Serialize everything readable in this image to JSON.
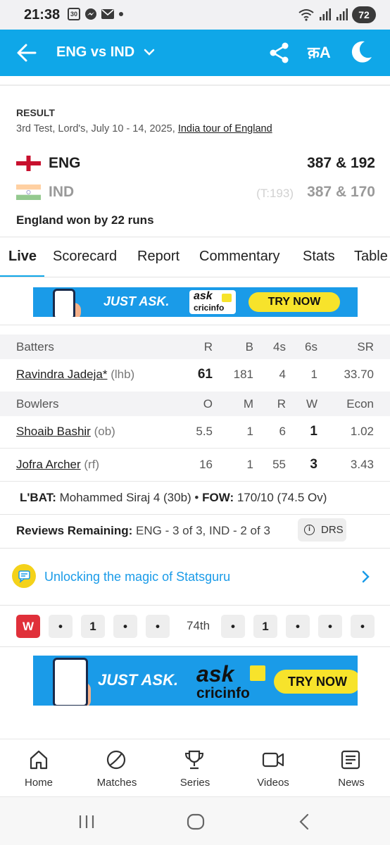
{
  "status_bar": {
    "time": "21:38",
    "notification_box": "30",
    "battery": "72"
  },
  "header": {
    "title": "ENG vs IND",
    "lang_toggle": "क़A"
  },
  "match": {
    "result_label": "RESULT",
    "description": "3rd Test, Lord's, July 10 - 14, 2025, ",
    "series_link": "India tour of England",
    "teams": [
      {
        "name": "ENG",
        "score": "387 & 192",
        "target": ""
      },
      {
        "name": "IND",
        "score": "387 & 170",
        "target": "(T:193)"
      }
    ],
    "result_text": "England won by 22 runs"
  },
  "tabs": [
    "Live",
    "Scorecard",
    "Report",
    "Commentary",
    "Stats",
    "Table"
  ],
  "ads": {
    "just_ask": "JUST ASK.",
    "logo_ask": "ask",
    "logo_cricinfo": "cricinfo",
    "try_now": "TRY NOW"
  },
  "batters": {
    "headers": [
      "Batters",
      "R",
      "B",
      "4s",
      "6s",
      "SR"
    ],
    "rows": [
      {
        "name": "Ravindra Jadeja*",
        "style": "(lhb)",
        "r": "61",
        "b": "181",
        "fours": "4",
        "sixes": "1",
        "sr": "33.70"
      }
    ]
  },
  "bowlers": {
    "headers": [
      "Bowlers",
      "O",
      "M",
      "R",
      "W",
      "Econ"
    ],
    "rows": [
      {
        "name": "Shoaib Bashir",
        "style": "(ob)",
        "o": "5.5",
        "m": "1",
        "r": "6",
        "w": "1",
        "econ": "1.02"
      },
      {
        "name": "Jofra Archer",
        "style": "(rf)",
        "o": "16",
        "m": "1",
        "r": "55",
        "w": "3",
        "econ": "3.43"
      }
    ]
  },
  "last_bat": {
    "label": "L'BAT:",
    "text": " Mohammed Siraj 4 (30b) • ",
    "fow_label": "FOW:",
    "fow_text": " 170/10 (74.5 Ov)"
  },
  "reviews": {
    "label": "Reviews Remaining:",
    "text": " ENG - 3 of 3, IND - 2 of 3",
    "drs": "DRS"
  },
  "statsguru": {
    "text": "Unlocking the magic of Statsguru"
  },
  "timeline": {
    "balls_current": [
      "W",
      "•",
      "1",
      "•",
      "•"
    ],
    "over_label": "74th",
    "balls_previous": [
      "•",
      "1",
      "•",
      "•",
      "•"
    ]
  },
  "bottom_nav": [
    {
      "label": "Home",
      "icon": "home-icon"
    },
    {
      "label": "Matches",
      "icon": "ball-icon"
    },
    {
      "label": "Series",
      "icon": "trophy-icon"
    },
    {
      "label": "Videos",
      "icon": "video-icon"
    },
    {
      "label": "News",
      "icon": "news-icon"
    }
  ],
  "colors": {
    "brand": "#0fa7e8",
    "wicket": "#e0303a",
    "ad_yellow": "#f7e32b"
  }
}
